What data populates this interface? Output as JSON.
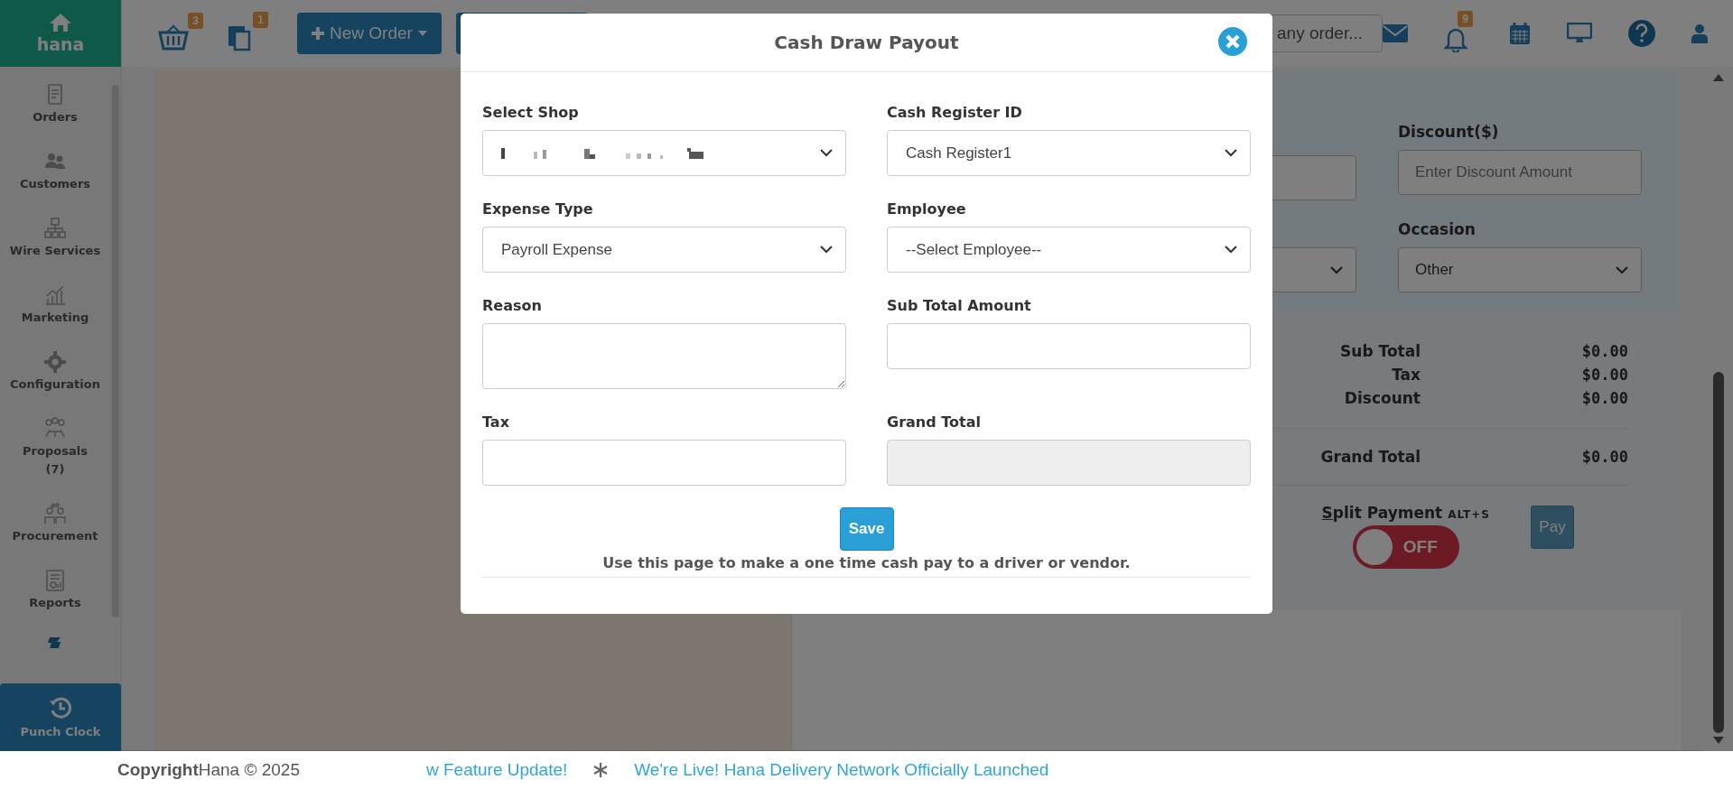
{
  "sidebar": {
    "logo": "hana",
    "items": [
      {
        "label": "Orders"
      },
      {
        "label": "Customers"
      },
      {
        "label": "Wire Services"
      },
      {
        "label": "Marketing"
      },
      {
        "label": "Configuration"
      },
      {
        "label": "Proposals",
        "count": "(7)"
      },
      {
        "label": "Procurement"
      },
      {
        "label": "Reports"
      }
    ],
    "punch_clock": "Punch Clock"
  },
  "topbar": {
    "cart_badge": "3",
    "copies_badge": "1",
    "new_order": "New Order",
    "search": {
      "placeholder": "any order..."
    },
    "bell_badge": "9"
  },
  "order_panel": {
    "discount": {
      "label": "Discount($)",
      "placeholder": "Enter Discount Amount"
    },
    "occasion": {
      "label": "Occasion",
      "value": "Other"
    },
    "summary": [
      {
        "label": "Sub Total",
        "value": "$0.00"
      },
      {
        "label": "Tax",
        "value": "$0.00"
      },
      {
        "label": "Discount",
        "value": "$0.00"
      }
    ],
    "grand_total": {
      "label": "Grand Total",
      "value": "$0.00"
    },
    "split_payment": {
      "label": "Split Payment",
      "shortcut": "ALT+S",
      "on": false,
      "state_text": "OFF"
    },
    "pay": "Pay"
  },
  "modal": {
    "title": "Cash Draw Payout",
    "fields": [
      {
        "label": "Select Shop",
        "kind": "select",
        "blurred": true
      },
      {
        "label": "Cash Register ID",
        "kind": "select",
        "value": "Cash Register1"
      },
      {
        "label": "Expense Type",
        "kind": "select",
        "value": "Payroll Expense"
      },
      {
        "label": "Employee",
        "kind": "select",
        "value": "--Select Employee--"
      },
      {
        "label": "Reason",
        "kind": "textarea"
      },
      {
        "label": "Sub Total Amount",
        "kind": "input"
      },
      {
        "label": "Tax",
        "kind": "input"
      },
      {
        "label": "Grand Total",
        "kind": "readonly"
      }
    ],
    "save": "Save",
    "note": "Use this page to make a one time cash pay to a driver or vendor."
  },
  "footer": {
    "copyright_bold": "Copyright",
    "copyright": "Hana © 2025",
    "ticker": [
      "w Feature Update!",
      "We're Live! Hana Delivery Network Officially Launched"
    ]
  }
}
